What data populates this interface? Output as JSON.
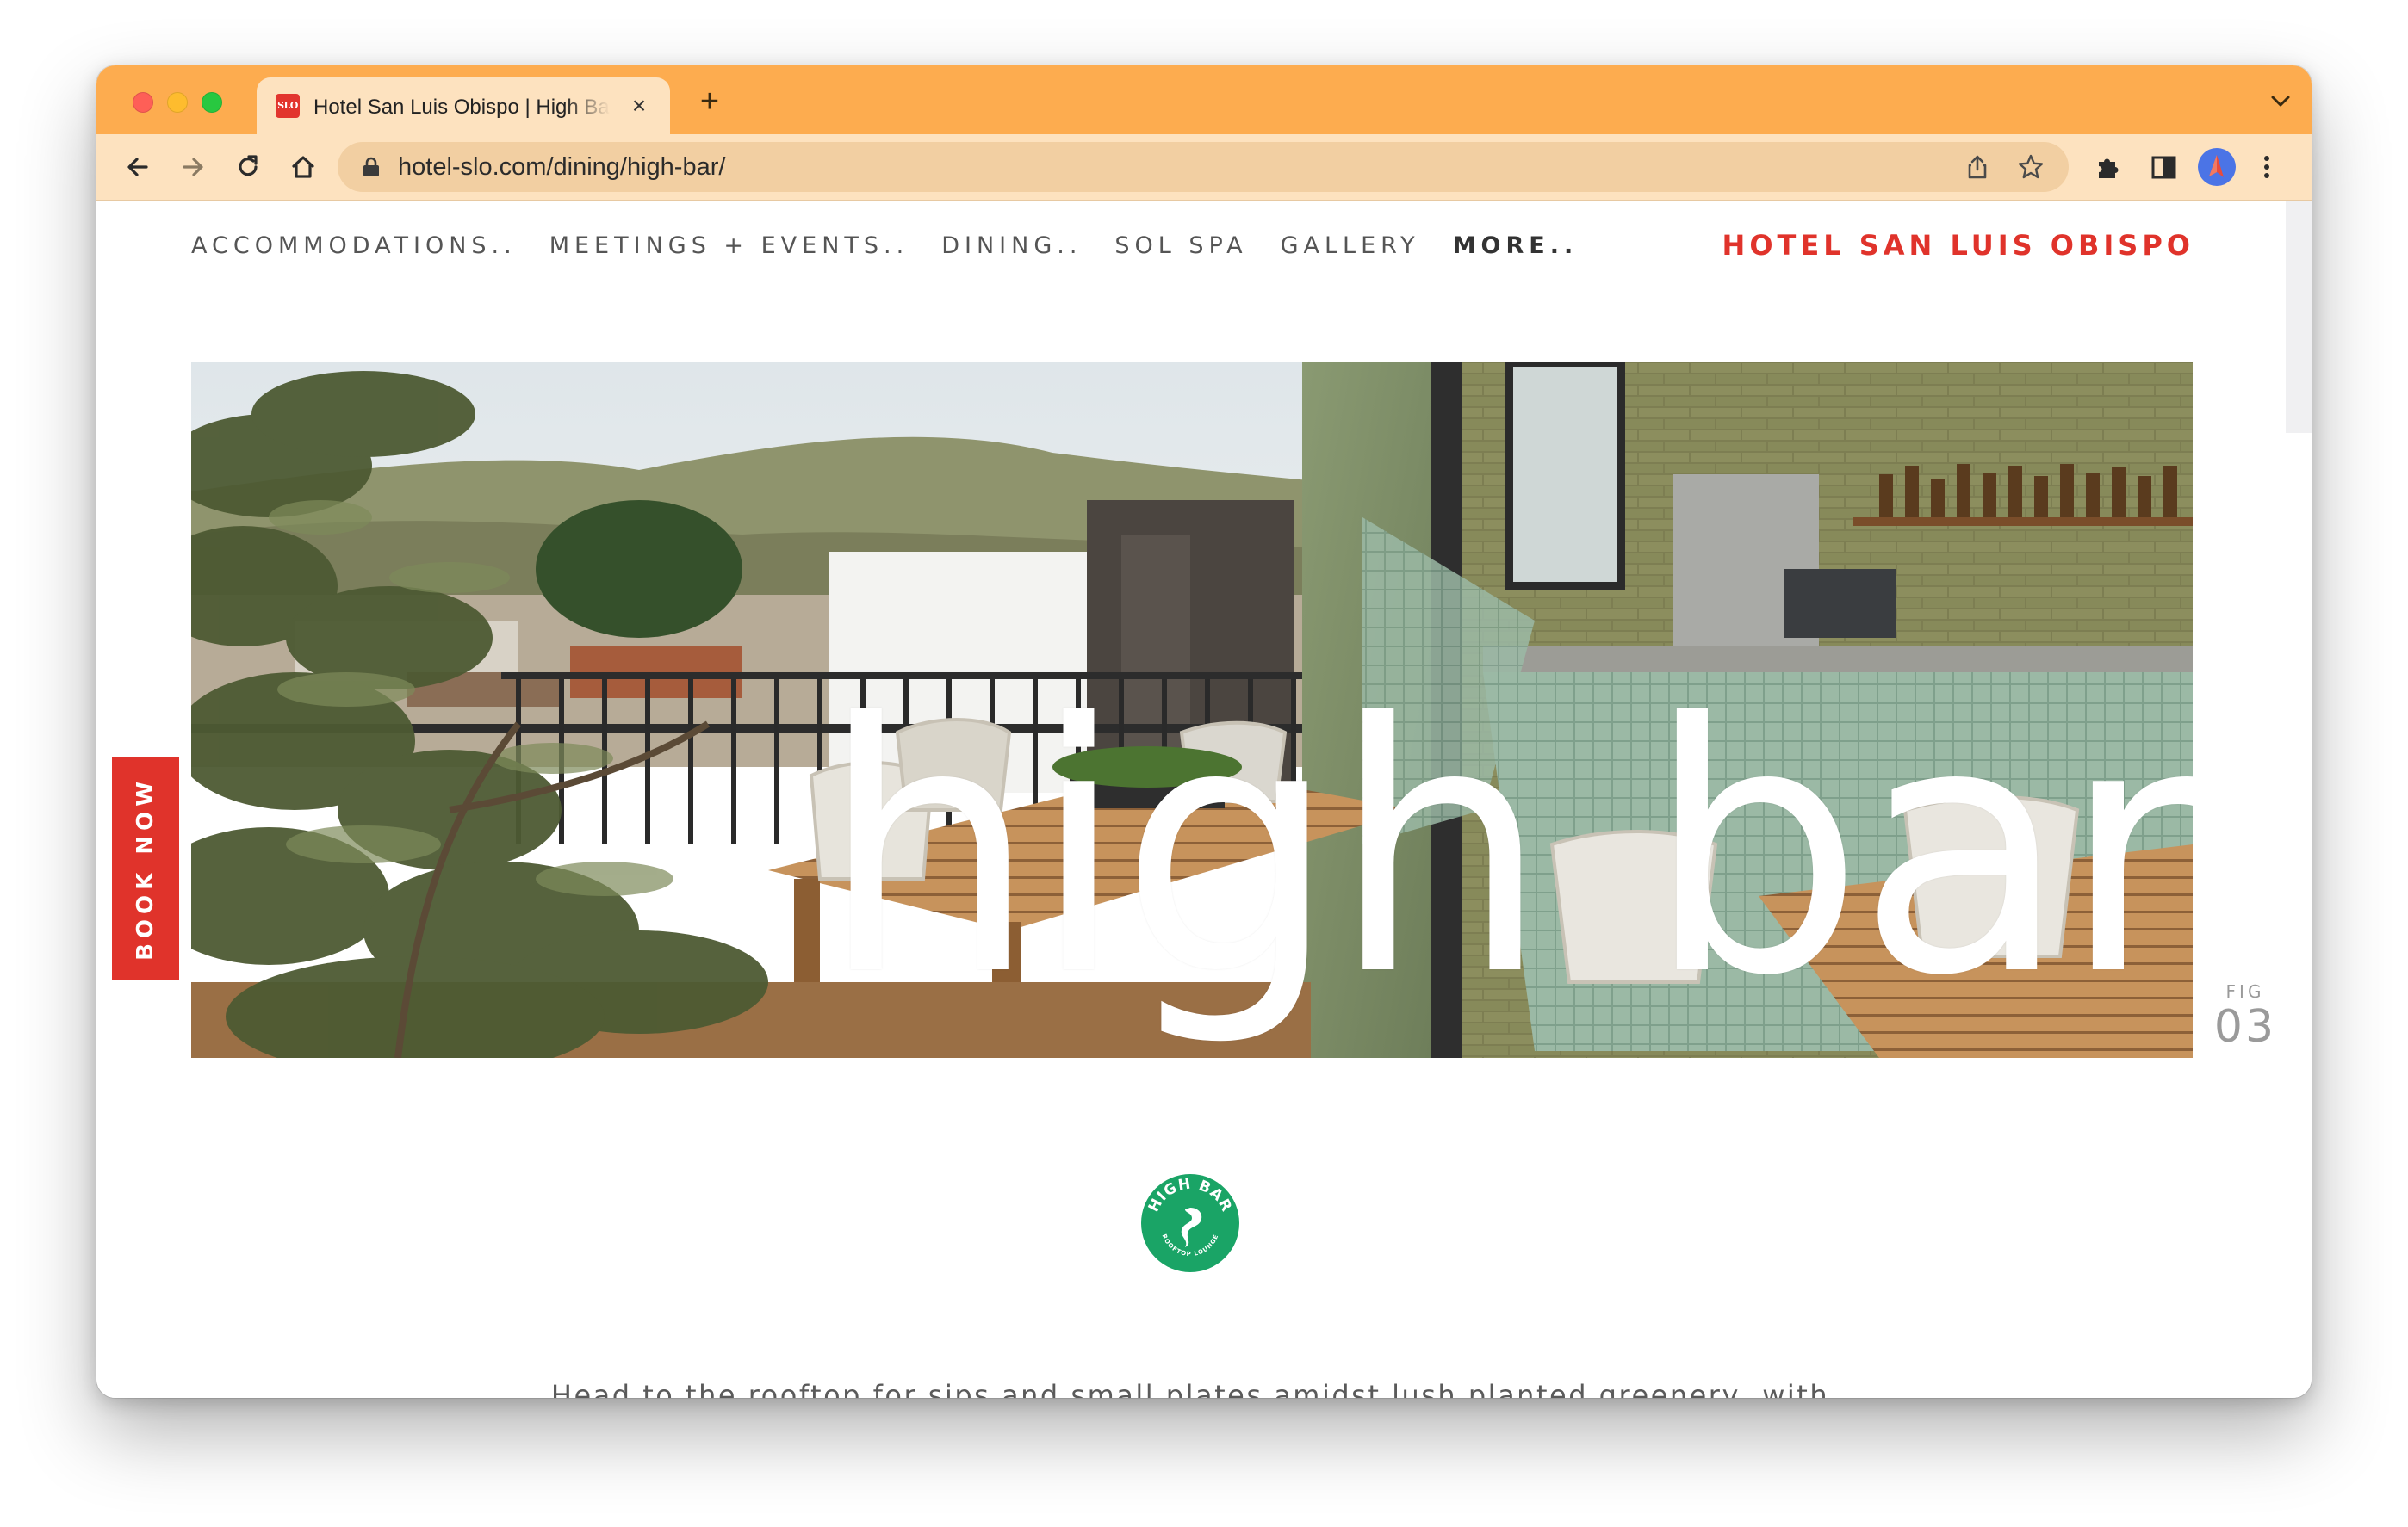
{
  "browser": {
    "tab_title": "Hotel San Luis Obispo | High Bar",
    "favicon_text": "SLO",
    "url": "hotel-slo.com/dining/high-bar/",
    "accent_color": "#fdac4f"
  },
  "site": {
    "nav": [
      {
        "label": "ACCOMMODATIONS.."
      },
      {
        "label": "MEETINGS + EVENTS.."
      },
      {
        "label": "DINING.."
      },
      {
        "label": "SOL SPA"
      },
      {
        "label": "GALLERY"
      },
      {
        "label": "MORE.."
      }
    ],
    "brand": "HOTEL SAN LUIS OBISPO",
    "brand_color": "#e0332b",
    "book_now": "BOOK NOW",
    "hero": {
      "title": "high bar",
      "fig_label": "FIG",
      "fig_number": "03"
    },
    "logo": {
      "top_text": "HIGH BAR",
      "bottom_text": "ROOFTOP LOUNGE",
      "color": "#1aa466"
    },
    "body_text": "Head to the rooftop for sips and small plates amidst lush planted greenery, with stellar views over the rolling hills. If you're more in the mood for action than lounging, gather some"
  },
  "icons": [
    "back-icon",
    "forward-icon",
    "reload-icon",
    "home-icon",
    "lock-icon",
    "share-icon",
    "star-icon",
    "extensions-icon",
    "sidepanel-icon",
    "profile-icon",
    "menu-icon",
    "tab-list-icon"
  ]
}
